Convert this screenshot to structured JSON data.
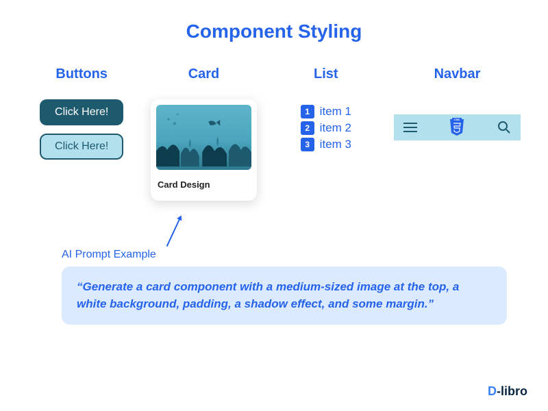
{
  "title": "Component Styling",
  "columns": {
    "buttons": {
      "header": "Buttons",
      "btn1": "Click Here!",
      "btn2": "Click Here!"
    },
    "card": {
      "header": "Card",
      "caption": "Card Design"
    },
    "list": {
      "header": "List",
      "items": [
        {
          "num": "1",
          "label": "item 1"
        },
        {
          "num": "2",
          "label": "item 2"
        },
        {
          "num": "3",
          "label": "item 3"
        }
      ]
    },
    "navbar": {
      "header": "Navbar",
      "logo_text": "CSS"
    }
  },
  "prompt": {
    "label": "AI Prompt Example",
    "text": "“Generate a card component with a medium-sized image at the top, a white background, padding, a shadow effect, and some margin.”"
  },
  "brand": {
    "d": "D",
    "rest": "-libro"
  }
}
